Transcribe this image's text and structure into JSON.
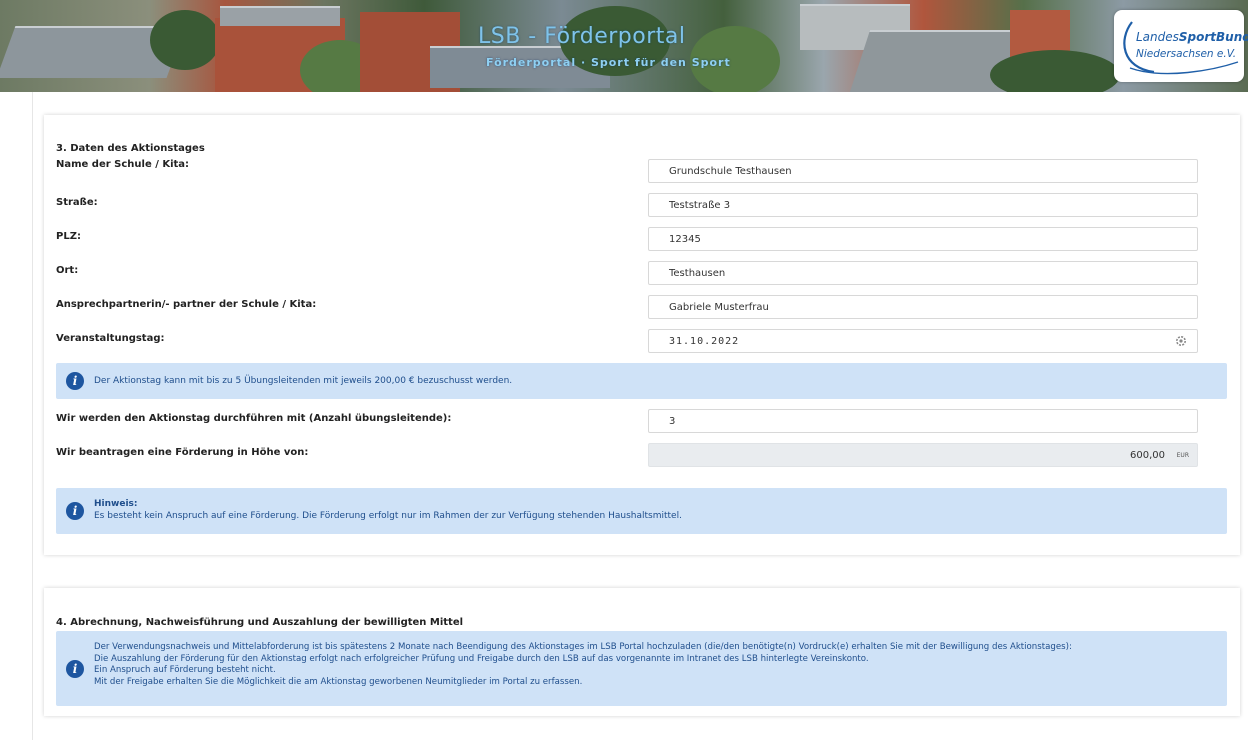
{
  "header": {
    "title": "LSB - Förderportal",
    "subtitle": "Förderportal · Sport für den Sport",
    "logo_line1_a": "Landes",
    "logo_line1_b": "SportBund",
    "logo_line2": "Niedersachsen e.V."
  },
  "section3": {
    "title": "3. Daten des Aktionstages",
    "fields": [
      {
        "label": "Name der Schule / Kita:",
        "value": "Grundschule Testhausen"
      },
      {
        "label": "Straße:",
        "value": "Teststraße 3"
      },
      {
        "label": "PLZ:",
        "value": "12345"
      },
      {
        "label": "Ort:",
        "value": "Testhausen"
      },
      {
        "label": "Ansprechpartnerin/- partner der Schule / Kita:",
        "value": "Gabriele Musterfrau"
      },
      {
        "label": "Veranstaltungstag:",
        "value": "31.10.2022"
      }
    ],
    "info_text": "Der Aktionstag kann mit bis zu 5 Übungsleitenden mit jeweils 200,00 € bezuschusst werden.",
    "count_label": "Wir werden den Aktionstag durchführen mit (Anzahl übungsleitende):",
    "count_value": "3",
    "amount_label": "Wir beantragen eine Förderung in Höhe von:",
    "amount_value": "600,00",
    "amount_unit": "EUR",
    "note_title": "Hinweis:",
    "note_text": "Es besteht kein Anspruch auf eine Förderung. Die Förderung erfolgt nur im Rahmen der zur Verfügung stehenden Haushaltsmittel."
  },
  "section4": {
    "title": "4. Abrechnung, Nachweisführung und Auszahlung der bewilligten Mittel",
    "lines": [
      "Der Verwendungsnachweis und Mittelabforderung ist bis spätestens 2 Monate nach Beendigung des Aktionstages im LSB Portal hochzuladen (die/den benötigte(n) Vordruck(e) erhalten Sie mit der Bewilligung des Aktionstages):",
      "Die Auszahlung der Förderung für den Aktionstag erfolgt nach erfolgreicher Prüfung und Freigabe durch den LSB auf das vorgenannte im Intranet des LSB hinterlegte Vereinskonto.",
      "Ein Anspruch auf Förderung besteht nicht.",
      "Mit der Freigabe erhalten Sie die Möglichkeit die am Aktionstag geworbenen Neumitglieder im Portal zu erfassen."
    ]
  },
  "colors": {
    "info_bg": "#cfe2f7",
    "info_icon": "#1e56a0",
    "info_text": "#1f4e8c",
    "readonly_bg": "#e9ecef"
  }
}
